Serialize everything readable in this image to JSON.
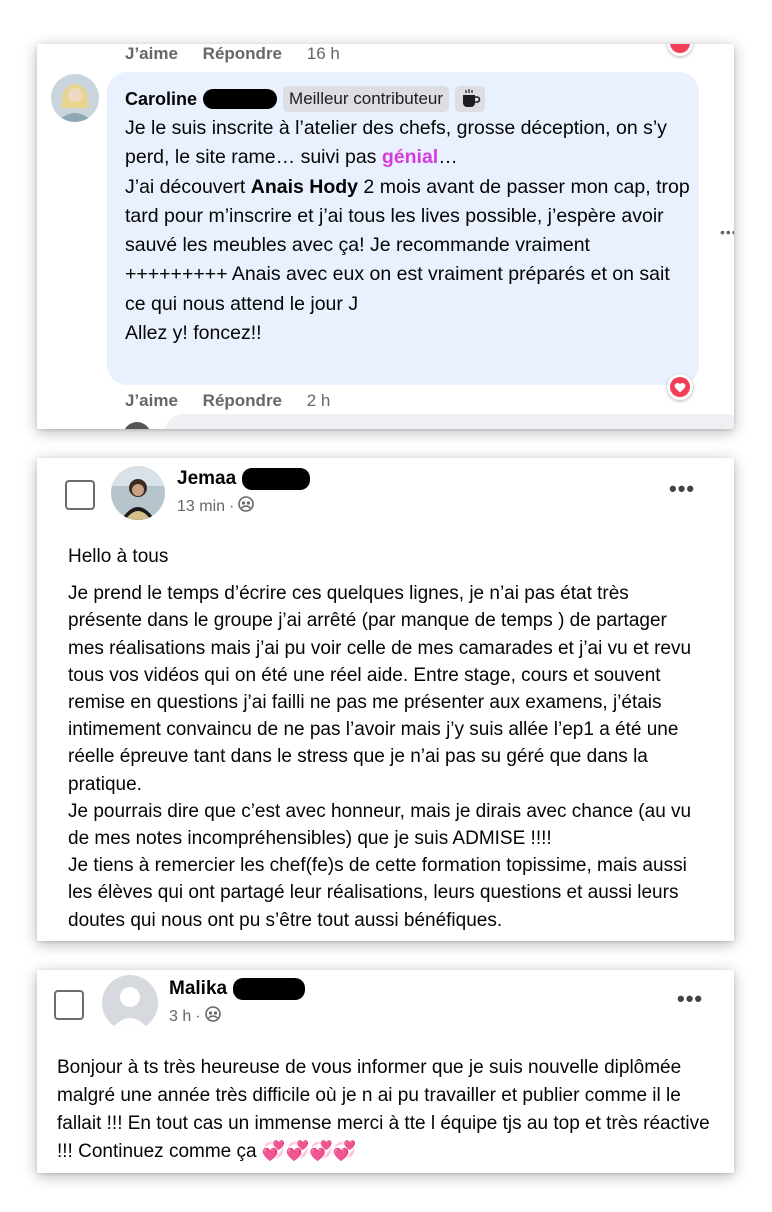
{
  "comment1": {
    "top_actions": {
      "like": "J’aime",
      "reply": "Répondre",
      "time": "16 h"
    },
    "author": "Caroline",
    "badge": "Meilleur contributeur",
    "badge_icon": "coffee-cup-icon",
    "text_parts": {
      "p1": "Je le suis inscrite à l’atelier des chefs, grosse déception, on s’y perd, le site rame… suivi pas ",
      "highlight": "génial",
      "p2": "…\nJ’ai découvert ",
      "bold_name": "Anais Hody",
      "p3": " 2 mois avant de passer mon cap, trop tard pour m’inscrire et j’ai tous les lives possible, j’espère avoir sauvé les meubles avec ça! Je recommande vraiment +++++++++ Anais avec eux on est vraiment préparés et on sait ce qui nous attend le jour J\nAllez y! foncez!!"
    },
    "bottom_actions": {
      "like": "J’aime",
      "reply": "Répondre",
      "time": "2 h"
    },
    "reaction_icon": "heart-reaction-icon",
    "colors": {
      "bubble": "#e8f1fd",
      "highlight": "#d63cdc",
      "heart": "#f33e58"
    }
  },
  "post1": {
    "author": "Jemaa",
    "time": "13 min",
    "audience_icon": "group-audience-icon",
    "more_icon": "more-dots-icon",
    "paragraphs": [
      "Hello à tous",
      "Je prend le temps d’écrire ces quelques lignes, je n’ai pas état très présente dans le groupe j’ai arrêté (par manque de temps ) de partager mes réalisations mais j’ai pu voir celle de mes camarades et j’ai vu et revu tous vos vidéos qui on été une réel aide. Entre stage, cours et souvent remise en questions j’ai failli ne pas me présenter aux examens, j’étais intimement convaincu de ne pas l’avoir mais j’y suis allée l’ep1 a été une réelle épreuve tant dans le stress que je n’ai pas su géré que dans la pratique.\nJe pourrais dire que c’est avec honneur, mais je dirais avec chance (au vu de mes notes incompréhensibles) que je suis ADMISE !!!!\nJe tiens à remercier les chef(fe)s de cette formation topissime, mais aussi les élèves qui ont partagé leur réalisations, leurs questions et aussi leurs doutes qui nous ont pu s’être tout aussi bénéfiques."
    ]
  },
  "post2": {
    "author": "Malika",
    "time": "3 h",
    "audience_icon": "group-audience-icon",
    "more_icon": "more-dots-icon",
    "text": "Bonjour à ts très heureuse de vous informer que je suis nouvelle diplômée malgré une année très difficile où je n ai pu travailler et publier comme il le fallait !!! En tout cas un immense merci à tte l équipe tjs au top et très réactive !!! Continuez comme ça 💞💞💞💞"
  }
}
